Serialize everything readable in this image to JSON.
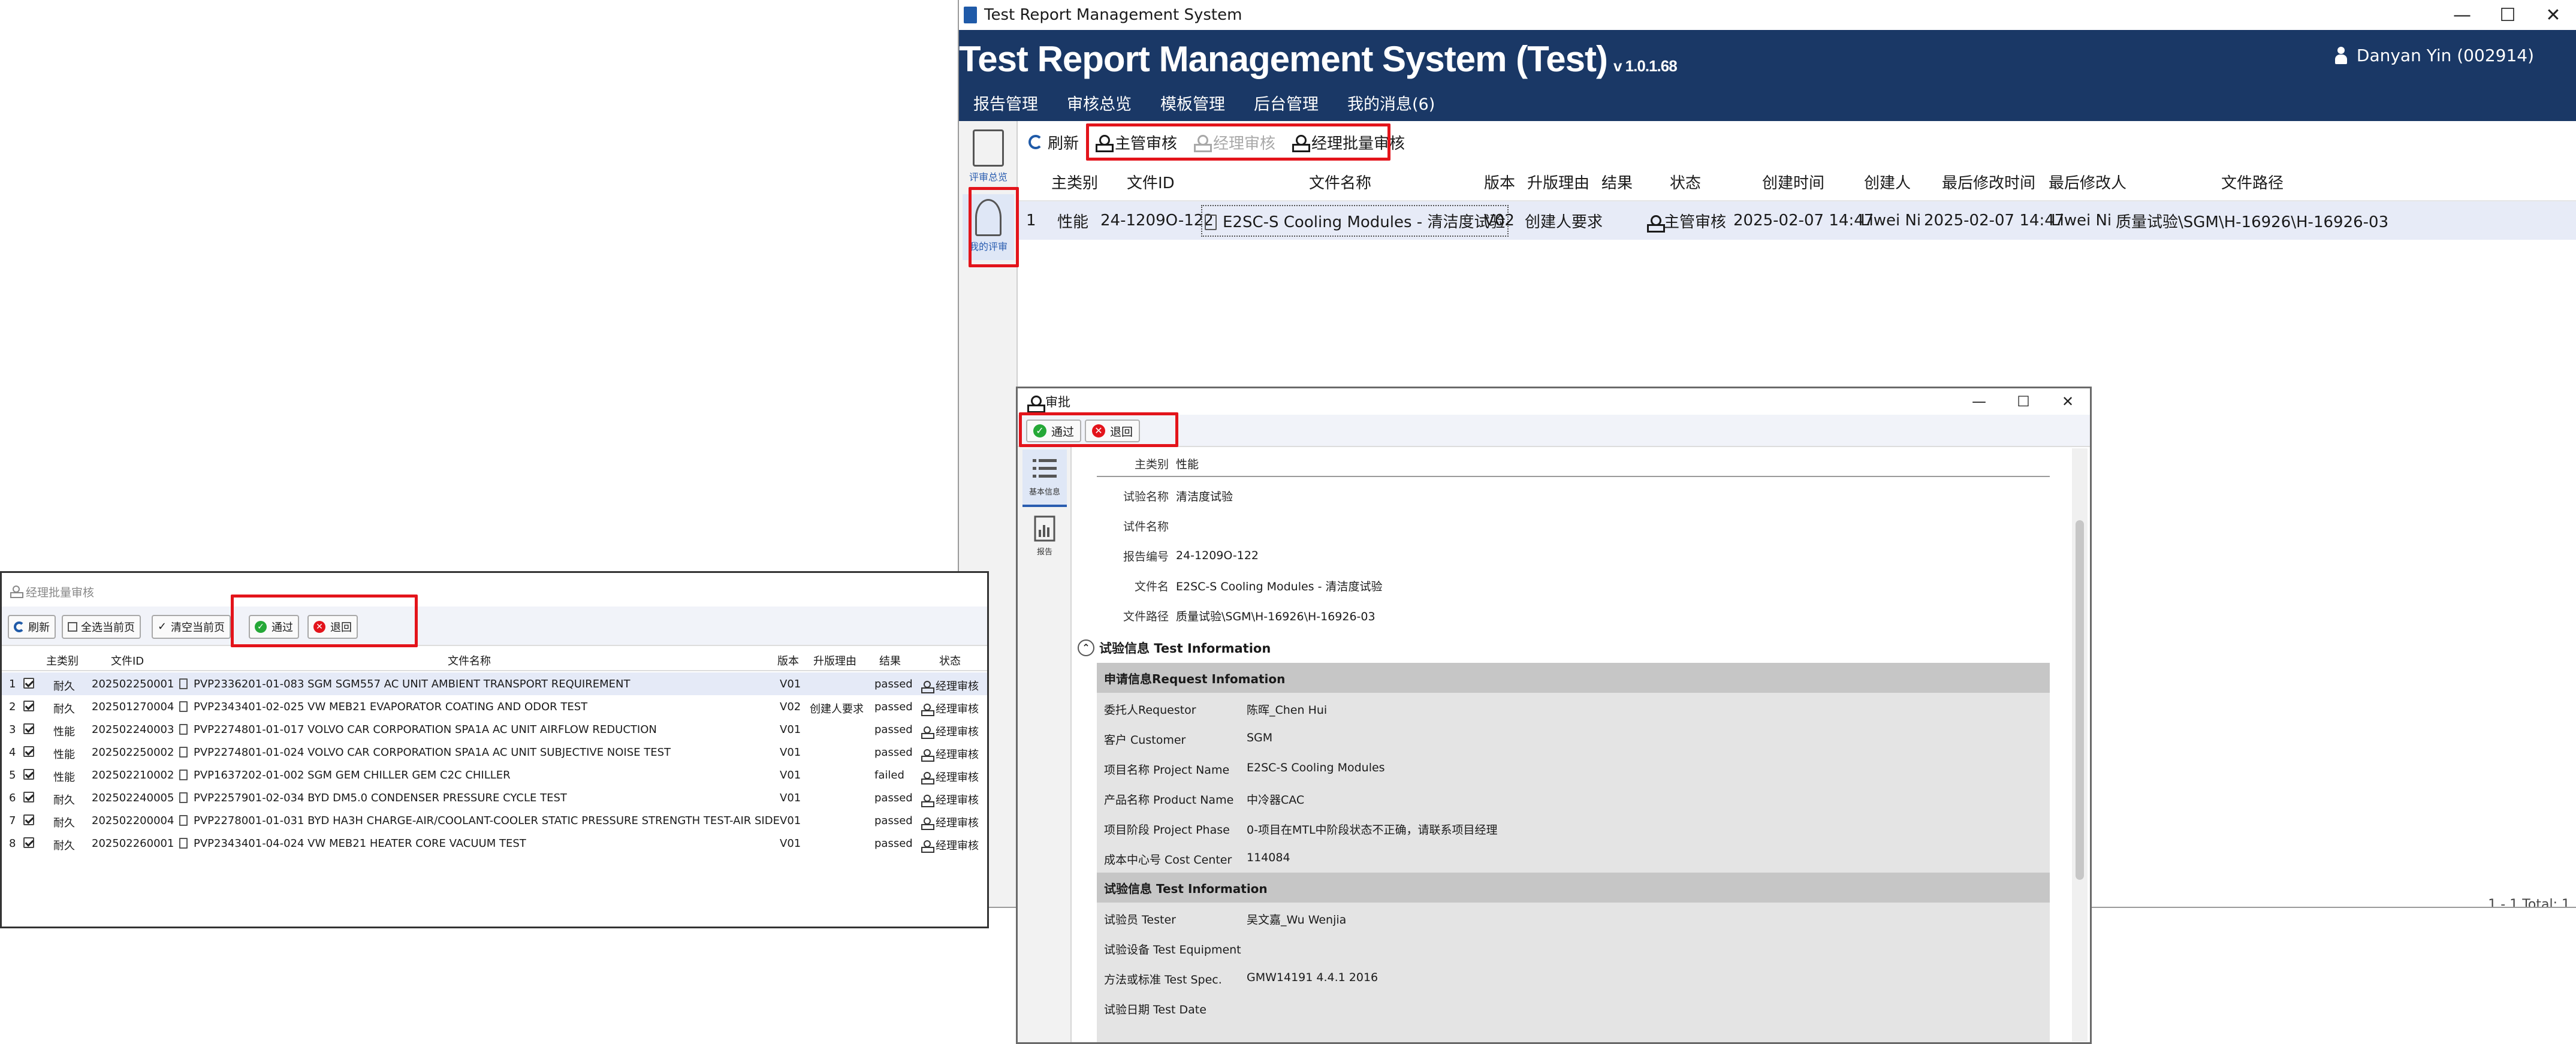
{
  "main_window": {
    "titlebar": "Test Report Management System",
    "app_title": "Test Report Management System (Test)",
    "version": "v 1.0.1.68",
    "user": "Danyan Yin (002914)",
    "menu": [
      "报告管理",
      "审核总览",
      "模板管理",
      "后台管理",
      "我的消息(6)"
    ],
    "side_nav": [
      {
        "label": "评审总览",
        "icon": "review-overview-icon"
      },
      {
        "label": "我的评审",
        "icon": "stamp-icon"
      }
    ],
    "toolbar": {
      "refresh": "刷新",
      "supervisor_review": "主管审核",
      "manager_review": "经理审核",
      "manager_batch_review": "经理批量审核"
    },
    "grid": {
      "columns": [
        "主类别",
        "文件ID",
        "文件名称",
        "版本",
        "升版理由",
        "结果",
        "状态",
        "创建时间",
        "创建人",
        "最后修改时间",
        "最后修改人",
        "文件路径"
      ],
      "rows": [
        {
          "index": "1",
          "category": "性能",
          "file_id": "24-1209O-122",
          "file_name": "E2SC-S Cooling Modules - 清洁度试验",
          "version": "V02",
          "reason": "创建人要求",
          "result": "",
          "status": "主管审核",
          "created": "2025-02-07 14:47",
          "creator": "Liwei Ni",
          "modified": "2025-02-07 14:47",
          "modifier": "Liwei Ni",
          "path": "质量试验\\SGM\\H-16926\\H-16926-03"
        }
      ]
    },
    "status_footer": "1 - 1  Total: 1"
  },
  "approve_dialog": {
    "title": "审批",
    "pass_label": "通过",
    "return_label": "退回",
    "nav": [
      {
        "label": "基本信息",
        "icon": "list-icon"
      },
      {
        "label": "报告",
        "icon": "report-icon"
      }
    ],
    "fields": [
      {
        "label": "主类别",
        "value": "性能"
      },
      {
        "label": "试验名称",
        "value": "清洁度试验"
      },
      {
        "label": "试件名称",
        "value": ""
      },
      {
        "label": "报告编号",
        "value": "24-1209O-122"
      },
      {
        "label": "文件名",
        "value": "E2SC-S Cooling Modules - 清洁度试验"
      },
      {
        "label": "文件路径",
        "value": "质量试验\\SGM\\H-16926\\H-16926-03"
      }
    ],
    "section_title": "试验信息 Test Information",
    "request_head": "申请信息Request Infomation",
    "request_rows": [
      {
        "k": "委托人Requestor",
        "v": "陈晖_Chen Hui"
      },
      {
        "k": "客户 Customer",
        "v": "SGM"
      },
      {
        "k": "项目名称 Project Name",
        "v": "E2SC-S Cooling Modules"
      },
      {
        "k": "产品名称 Product Name",
        "v": "中冷器CAC"
      },
      {
        "k": "项目阶段 Project Phase",
        "v": "0-项目在MTL中阶段状态不正确，请联系项目经理"
      },
      {
        "k": "成本中心号 Cost Center",
        "v": "114084"
      }
    ],
    "test_head": "试验信息 Test Information",
    "test_rows": [
      {
        "k": "试验员 Tester",
        "v": "吴文嘉_Wu Wenjia"
      },
      {
        "k": "试验设备 Test Equipment",
        "v": ""
      },
      {
        "k": "方法或标准 Test Spec.",
        "v": "GMW14191 4.4.1 2016"
      },
      {
        "k": "试验日期 Test Date",
        "v": ""
      }
    ]
  },
  "batch_dialog": {
    "title": "经理批量审核",
    "toolbar": {
      "refresh": "刷新",
      "select_page": "全选当前页",
      "clear_page": "清空当前页",
      "pass": "通过",
      "return": "退回"
    },
    "columns": [
      "主类别",
      "文件ID",
      "文件名称",
      "版本",
      "升版理由",
      "结果",
      "状态"
    ],
    "rows": [
      {
        "i": "1",
        "cat": "耐久",
        "id": "202502250001",
        "name": "PVP2336201-01-083 SGM SGM557 AC UNIT AMBIENT TRANSPORT REQUIREMENT",
        "ver": "V01",
        "reason": "",
        "result": "passed",
        "status": "经理审核"
      },
      {
        "i": "2",
        "cat": "耐久",
        "id": "202501270004",
        "name": "PVP2343401-02-025 VW MEB21 EVAPORATOR COATING AND ODOR TEST",
        "ver": "V02",
        "reason": "创建人要求",
        "result": "passed",
        "status": "经理审核"
      },
      {
        "i": "3",
        "cat": "性能",
        "id": "202502240003",
        "name": "PVP2274801-01-017 VOLVO CAR CORPORATION SPA1A AC UNIT AIRFLOW REDUCTION",
        "ver": "V01",
        "reason": "",
        "result": "passed",
        "status": "经理审核"
      },
      {
        "i": "4",
        "cat": "性能",
        "id": "202502250002",
        "name": "PVP2274801-01-024 VOLVO CAR CORPORATION SPA1A AC UNIT SUBJECTIVE NOISE TEST",
        "ver": "V01",
        "reason": "",
        "result": "passed",
        "status": "经理审核"
      },
      {
        "i": "5",
        "cat": "性能",
        "id": "202502210002",
        "name": "PVP1637202-01-002 SGM GEM CHILLER GEM C2C CHILLER",
        "ver": "V01",
        "reason": "",
        "result": "failed",
        "status": "经理审核"
      },
      {
        "i": "6",
        "cat": "耐久",
        "id": "202502240005",
        "name": "PVP2257901-02-034 BYD DM5.0 CONDENSER PRESSURE CYCLE TEST",
        "ver": "V01",
        "reason": "",
        "result": "passed",
        "status": "经理审核"
      },
      {
        "i": "7",
        "cat": "耐久",
        "id": "202502200004",
        "name": "PVP2278001-01-031 BYD HA3H CHARGE-AIR/COOLANT-COOLER STATIC PRESSURE STRENGTH TEST-AIR SIDE",
        "ver": "V01",
        "reason": "",
        "result": "passed",
        "status": "经理审核"
      },
      {
        "i": "8",
        "cat": "耐久",
        "id": "202502260001",
        "name": "PVP2343401-04-024 VW MEB21 HEATER CORE VACUUM TEST",
        "ver": "V01",
        "reason": "",
        "result": "passed",
        "status": "经理审核"
      }
    ]
  },
  "colors": {
    "header_navy": "#1a3866",
    "highlight_red": "#e3141b",
    "selection_blue": "#e7ebf7",
    "pass_green": "#25a837"
  }
}
